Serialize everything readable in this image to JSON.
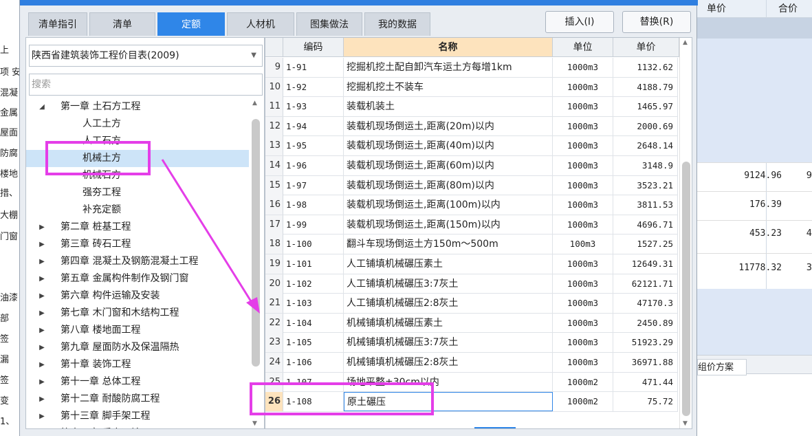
{
  "background": {
    "left_fragments": [
      "上",
      "项 安",
      "混凝",
      "金属",
      "屋面",
      "防腐",
      "楼地",
      "措、",
      "大棚",
      "门窗",
      "",
      "",
      "油漆",
      "部",
      "签",
      "漏",
      "签",
      "变",
      "1、"
    ],
    "right_headers": [
      "单价",
      "合价"
    ],
    "right_values": [
      {
        "val": "9124.96",
        "cut": "9"
      },
      {
        "val": "176.39",
        "cut": ""
      },
      {
        "val": "453.23",
        "cut": "4"
      },
      {
        "val": "11778.32",
        "cut": "3"
      }
    ],
    "right_tab": "组价方案"
  },
  "tabs": [
    {
      "label": "清单指引",
      "active": false
    },
    {
      "label": "清单",
      "active": false
    },
    {
      "label": "定额",
      "active": true
    },
    {
      "label": "人材机",
      "active": false
    },
    {
      "label": "图集做法",
      "active": false
    },
    {
      "label": "我的数据",
      "active": false
    }
  ],
  "buttons": {
    "insert": "插入(I)",
    "replace": "替换(R)"
  },
  "library_select": "陕西省建筑装饰工程价目表(2009)",
  "search_placeholder": "搜索",
  "tree": [
    {
      "label": "第一章 土石方工程",
      "level": 1,
      "caret": "◢"
    },
    {
      "label": "人工土方",
      "level": 2,
      "caret": ""
    },
    {
      "label": "人工石方",
      "level": 2,
      "caret": ""
    },
    {
      "label": "机械土方",
      "level": 2,
      "caret": "",
      "selected": true
    },
    {
      "label": "机械石方",
      "level": 2,
      "caret": ""
    },
    {
      "label": "强夯工程",
      "level": 2,
      "caret": ""
    },
    {
      "label": "补充定额",
      "level": 2,
      "caret": ""
    },
    {
      "label": "第二章 桩基工程",
      "level": 1,
      "caret": "▶"
    },
    {
      "label": "第三章 砖石工程",
      "level": 1,
      "caret": "▶"
    },
    {
      "label": "第四章 混凝土及钢筋混凝土工程",
      "level": 1,
      "caret": "▶"
    },
    {
      "label": "第五章 金属构件制作及钢门窗",
      "level": 1,
      "caret": "▶"
    },
    {
      "label": "第六章 构件运输及安装",
      "level": 1,
      "caret": "▶"
    },
    {
      "label": "第七章 木门窗和木结构工程",
      "level": 1,
      "caret": "▶"
    },
    {
      "label": "第八章 楼地面工程",
      "level": 1,
      "caret": "▶"
    },
    {
      "label": "第九章 屋面防水及保温隔热",
      "level": 1,
      "caret": "▶"
    },
    {
      "label": "第十章 装饰工程",
      "level": 1,
      "caret": "▶"
    },
    {
      "label": "第十一章 总体工程",
      "level": 1,
      "caret": "▶"
    },
    {
      "label": "第十二章 耐酸防腐工程",
      "level": 1,
      "caret": "▶"
    },
    {
      "label": "第十三章 脚手架工程",
      "level": 1,
      "caret": "▶"
    },
    {
      "label": "第十四章 垂直运输",
      "level": 1,
      "caret": "▶"
    }
  ],
  "grid": {
    "headers": [
      "编码",
      "名称",
      "单位",
      "单价"
    ],
    "rows": [
      {
        "no": "9",
        "code": "1-91",
        "name": "挖掘机挖土配自卸汽车运土方每增1km",
        "unit": "1000m3",
        "price": "1132.62"
      },
      {
        "no": "10",
        "code": "1-92",
        "name": "挖掘机挖土不装车",
        "unit": "1000m3",
        "price": "4188.79"
      },
      {
        "no": "11",
        "code": "1-93",
        "name": "装载机装土",
        "unit": "1000m3",
        "price": "1465.97"
      },
      {
        "no": "12",
        "code": "1-94",
        "name": "装载机现场倒运土,距离(20m)以内",
        "unit": "1000m3",
        "price": "2000.69"
      },
      {
        "no": "13",
        "code": "1-95",
        "name": "装载机现场倒运土,距离(40m)以内",
        "unit": "1000m3",
        "price": "2648.14"
      },
      {
        "no": "14",
        "code": "1-96",
        "name": "装载机现场倒运土,距离(60m)以内",
        "unit": "1000m3",
        "price": "3148.9"
      },
      {
        "no": "15",
        "code": "1-97",
        "name": "装载机现场倒运土,距离(80m)以内",
        "unit": "1000m3",
        "price": "3523.21"
      },
      {
        "no": "16",
        "code": "1-98",
        "name": "装载机现场倒运土,距离(100m)以内",
        "unit": "1000m3",
        "price": "3811.53"
      },
      {
        "no": "17",
        "code": "1-99",
        "name": "装载机现场倒运土,距离(150m)以内",
        "unit": "1000m3",
        "price": "4696.71"
      },
      {
        "no": "18",
        "code": "1-100",
        "name": "翻斗车现场倒运土方150m～500m",
        "unit": "100m3",
        "price": "1527.25"
      },
      {
        "no": "19",
        "code": "1-101",
        "name": "人工铺填机械碾压素土",
        "unit": "1000m3",
        "price": "12649.31"
      },
      {
        "no": "20",
        "code": "1-102",
        "name": "人工铺填机械碾压3:7灰土",
        "unit": "1000m3",
        "price": "62121.71"
      },
      {
        "no": "21",
        "code": "1-103",
        "name": "人工铺填机械碾压2:8灰土",
        "unit": "1000m3",
        "price": "47170.3"
      },
      {
        "no": "22",
        "code": "1-104",
        "name": "机械铺填机械碾压素土",
        "unit": "1000m3",
        "price": "2450.89"
      },
      {
        "no": "23",
        "code": "1-105",
        "name": "机械铺填机械碾压3:7灰土",
        "unit": "1000m3",
        "price": "51923.29"
      },
      {
        "no": "24",
        "code": "1-106",
        "name": "机械铺填机械碾压2:8灰土",
        "unit": "1000m3",
        "price": "36971.88"
      },
      {
        "no": "25",
        "code": "1-107",
        "name": "场地平整±30cm以内",
        "unit": "1000m2",
        "price": "471.44"
      },
      {
        "no": "26",
        "code": "1-108",
        "name": "原土碾压",
        "unit": "1000m2",
        "price": "75.72",
        "current": true
      }
    ]
  },
  "colors": {
    "accent": "#2f86e8",
    "highlight": "#e43ee8",
    "header_name": "#fde3bd"
  }
}
